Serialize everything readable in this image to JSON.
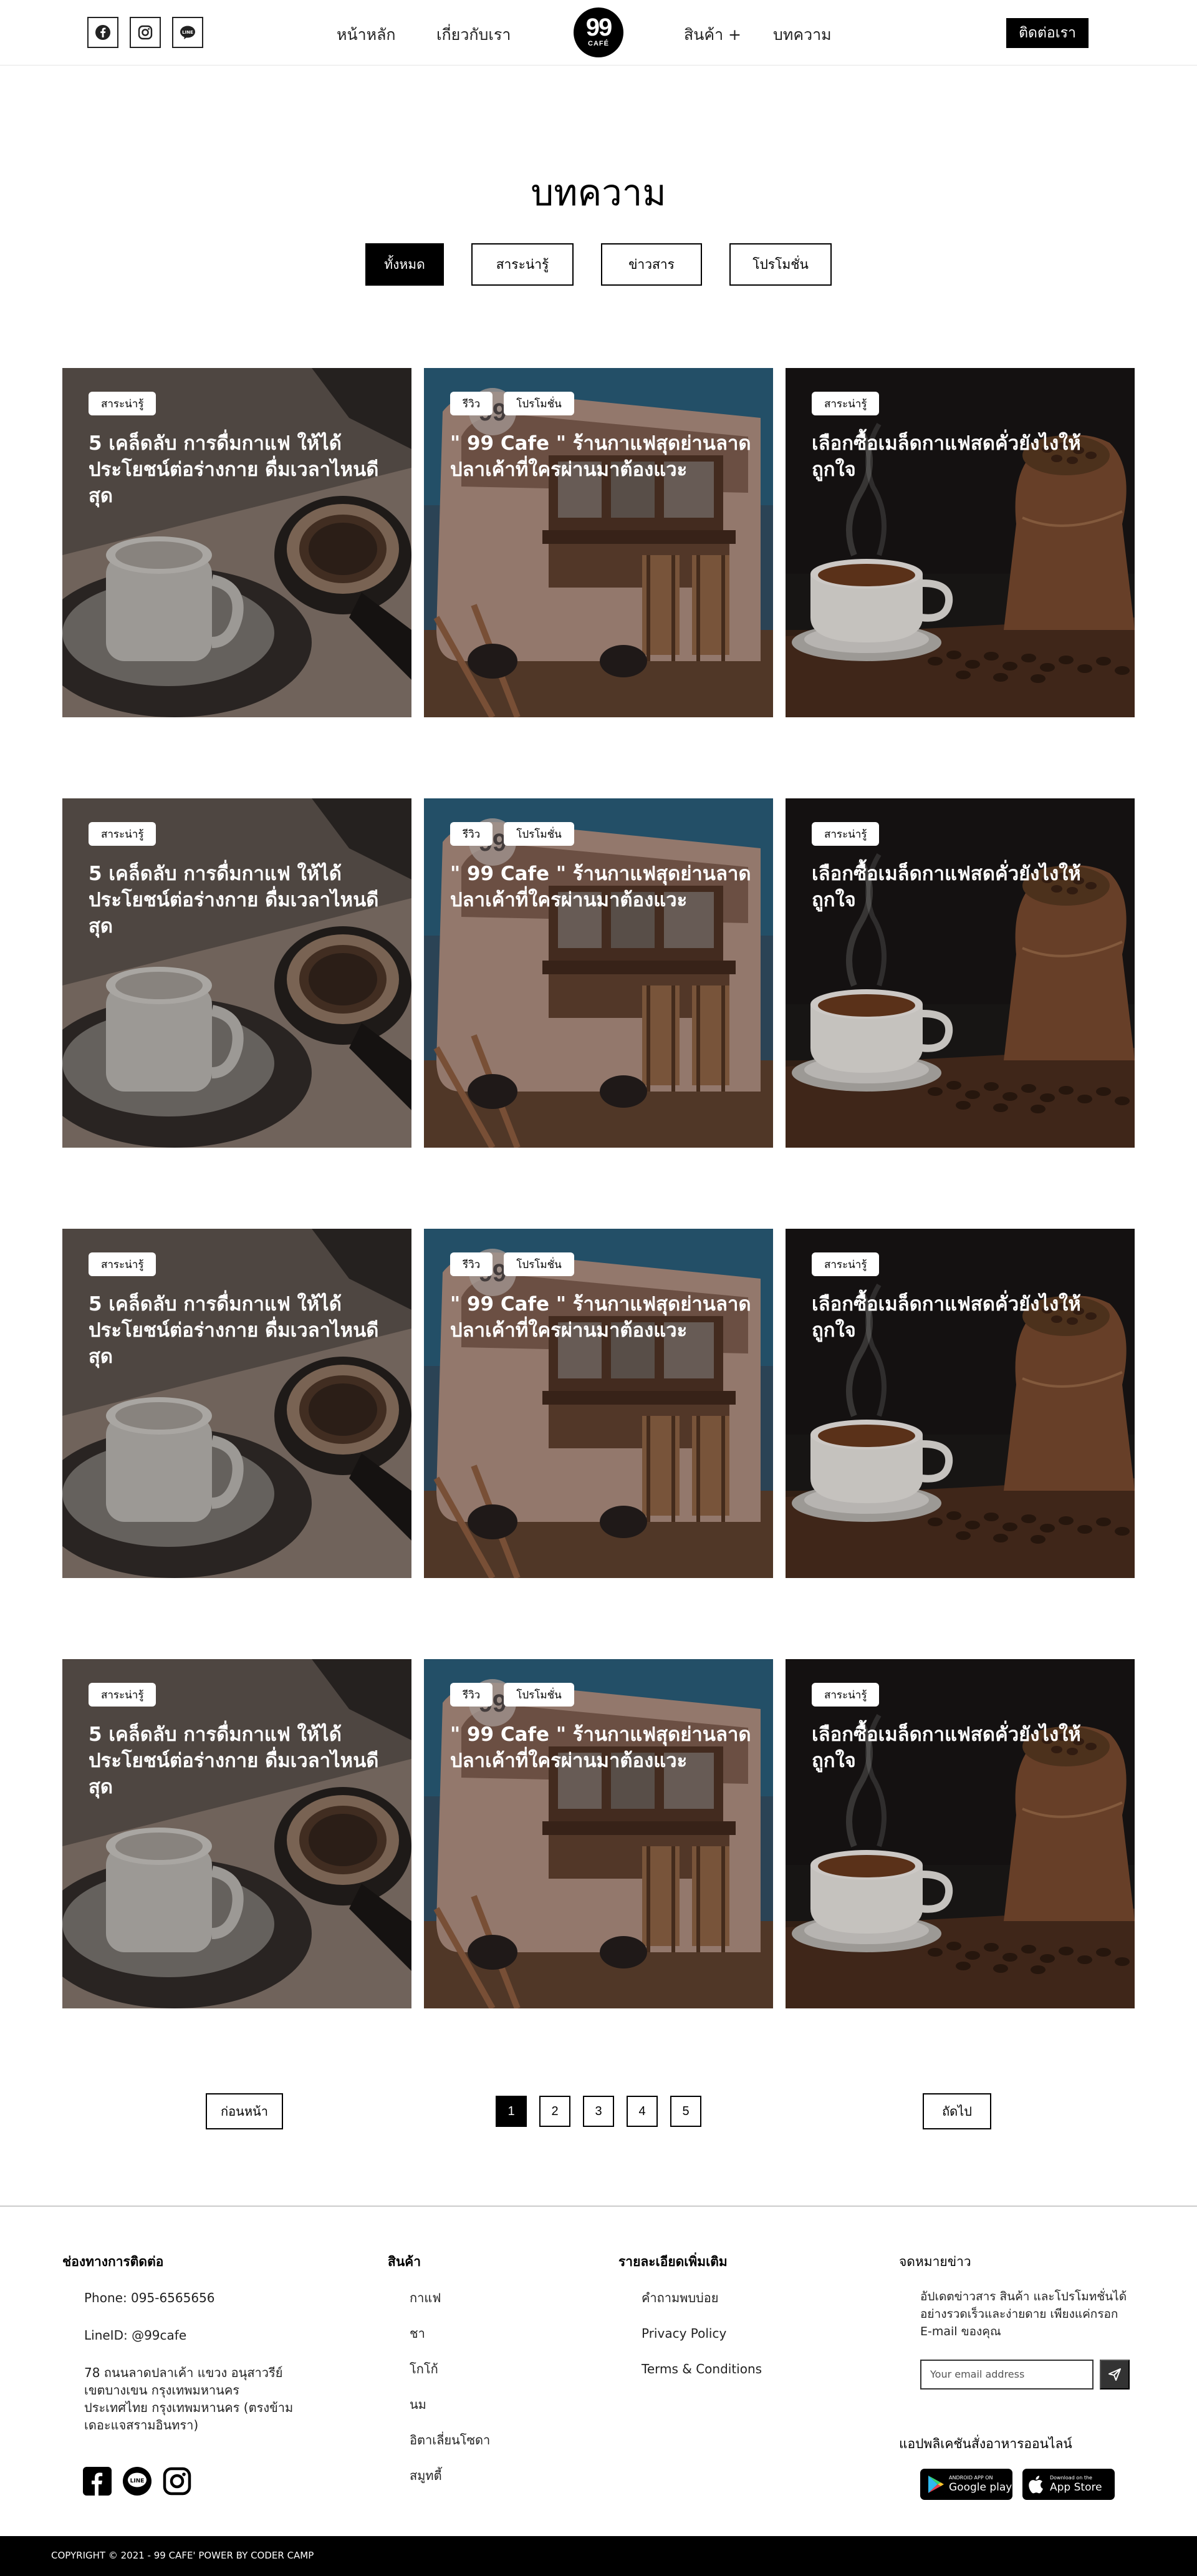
{
  "header": {
    "nav": [
      "หน้าหลัก",
      "เกี่ยวกับเรา",
      "สินค้า +",
      "บทความ"
    ],
    "logo_number": "99",
    "logo_text": "CAFÉ",
    "contact_label": "ติดต่อเรา",
    "social_icons": [
      "facebook-icon",
      "instagram-icon",
      "line-icon"
    ]
  },
  "page": {
    "title": "บทความ",
    "filters": [
      "ทั้งหมด",
      "สาระน่ารู้",
      "ข่าวสาร",
      "โปรโมชั่น"
    ],
    "active_filter": "ทั้งหมด"
  },
  "articles": [
    {
      "tags": [
        "สาระน่ารู้"
      ],
      "title": "5 เคล็ดลับ การดื่มกาแฟ ให้ได้ประโยชน์ต่อร่างกาย ดื่มเวลาไหนดีสุด",
      "image": "espresso-portafilter"
    },
    {
      "tags": [
        "รีวิว",
        "โปรโมชั่น"
      ],
      "title": "\" 99 Cafe \" ร้านกาแฟสุดย่านลาดปลาเค้าที่ใครผ่านมาต้องแวะ",
      "image": "coffee-truck"
    },
    {
      "tags": [
        "สาระน่ารู้"
      ],
      "title": "เลือกซื้อเมล็ดกาแฟสดคั่วยังไงให้ถูกใจ",
      "image": "coffee-cup-beans"
    },
    {
      "tags": [
        "สาระน่ารู้"
      ],
      "title": "5 เคล็ดลับ การดื่มกาแฟ ให้ได้ประโยชน์ต่อร่างกาย ดื่มเวลาไหนดีสุด",
      "image": "espresso-portafilter"
    },
    {
      "tags": [
        "รีวิว",
        "โปรโมชั่น"
      ],
      "title": "\" 99 Cafe \" ร้านกาแฟสุดย่านลาดปลาเค้าที่ใครผ่านมาต้องแวะ",
      "image": "coffee-truck"
    },
    {
      "tags": [
        "สาระน่ารู้"
      ],
      "title": "เลือกซื้อเมล็ดกาแฟสดคั่วยังไงให้ถูกใจ",
      "image": "coffee-cup-beans"
    },
    {
      "tags": [
        "สาระน่ารู้"
      ],
      "title": "5 เคล็ดลับ การดื่มกาแฟ ให้ได้ประโยชน์ต่อร่างกาย ดื่มเวลาไหนดีสุด",
      "image": "espresso-portafilter"
    },
    {
      "tags": [
        "รีวิว",
        "โปรโมชั่น"
      ],
      "title": "\" 99 Cafe \" ร้านกาแฟสุดย่านลาดปลาเค้าที่ใครผ่านมาต้องแวะ",
      "image": "coffee-truck"
    },
    {
      "tags": [
        "สาระน่ารู้"
      ],
      "title": "เลือกซื้อเมล็ดกาแฟสดคั่วยังไงให้ถูกใจ",
      "image": "coffee-cup-beans"
    },
    {
      "tags": [
        "สาระน่ารู้"
      ],
      "title": "5 เคล็ดลับ การดื่มกาแฟ ให้ได้ประโยชน์ต่อร่างกาย ดื่มเวลาไหนดีสุด",
      "image": "espresso-portafilter"
    },
    {
      "tags": [
        "รีวิว",
        "โปรโมชั่น"
      ],
      "title": "\" 99 Cafe \" ร้านกาแฟสุดย่านลาดปลาเค้าที่ใครผ่านมาต้องแวะ",
      "image": "coffee-truck"
    },
    {
      "tags": [
        "สาระน่ารู้"
      ],
      "title": "เลือกซื้อเมล็ดกาแฟสดคั่วยังไงให้ถูกใจ",
      "image": "coffee-cup-beans"
    }
  ],
  "pagination": {
    "prev_label": "ก่อนหน้า",
    "next_label": "ถัดไป",
    "pages": [
      "1",
      "2",
      "3",
      "4",
      "5"
    ],
    "current": "1"
  },
  "footer": {
    "contact": {
      "heading": "ช่องทางการติดต่อ",
      "phone": "Phone: 095-6565656",
      "line": "LineID: @99cafe",
      "address": "78 ถนนลาดปลาเค้า แขวง อนุสาวรีย์ เขตบางเขน กรุงเทพมหานคร ประเทศไทย กรุงเทพมหานคร (ตรงข้ามเดอะแจสรามอินทรา)",
      "social_icons": [
        "facebook-icon",
        "line-icon",
        "instagram-icon"
      ]
    },
    "products": {
      "heading": "สินค้า",
      "items": [
        "กาแฟ",
        "ชา",
        "โกโก้",
        "นม",
        "อิตาเลี่ยนโซดา",
        "สมูทตี้"
      ]
    },
    "more": {
      "heading": "รายละเอียดเพิ่มเติม",
      "items": [
        "คำถามพบบ่อย",
        "Privacy Policy",
        "Terms & Conditions"
      ]
    },
    "newsletter": {
      "heading": "จดหมายข่าว",
      "text": "อัปเดตข่าวสาร สินค้า และโปรโมทชั่นได้อย่างรวดเร็วและง่ายดาย เพียงแค่กรอก E-mail ของคุณ",
      "placeholder": "Your email address"
    },
    "apps": {
      "heading": "แอปพลิเคชันสั่งอาหารออนไลน์",
      "google_small": "ANDROID APP ON",
      "google_big": "Google play",
      "apple_small": "Download on the",
      "apple_big": "App Store"
    },
    "copyright": "COPYRIGHT © 2021 - 99 CAFE' POWER BY CODER CAMP"
  }
}
